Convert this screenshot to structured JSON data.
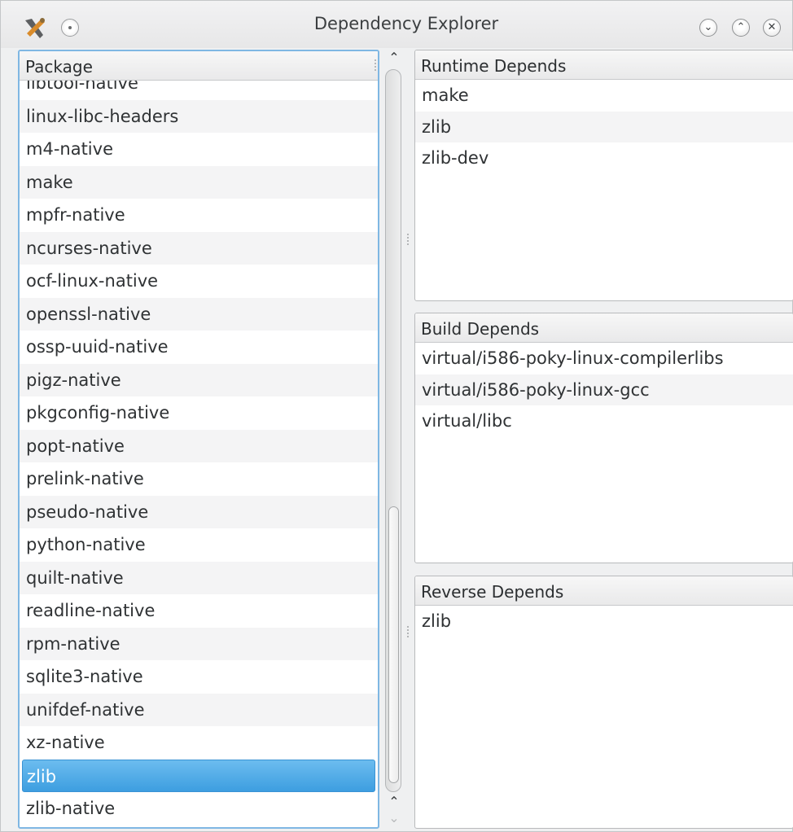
{
  "window": {
    "title": "Dependency Explorer",
    "buttons": [
      "minimize",
      "maximize",
      "close"
    ]
  },
  "package_list": {
    "header": "Package",
    "items": [
      "libtool-native",
      "linux-libc-headers",
      "m4-native",
      "make",
      "mpfr-native",
      "ncurses-native",
      "ocf-linux-native",
      "openssl-native",
      "ossp-uuid-native",
      "pigz-native",
      "pkgconfig-native",
      "popt-native",
      "prelink-native",
      "pseudo-native",
      "python-native",
      "quilt-native",
      "readline-native",
      "rpm-native",
      "sqlite3-native",
      "unifdef-native",
      "xz-native",
      "zlib",
      "zlib-native"
    ],
    "selected": "zlib"
  },
  "runtime_depends": {
    "header": "Runtime Depends",
    "items": [
      "make",
      "zlib",
      "zlib-dev"
    ]
  },
  "build_depends": {
    "header": "Build Depends",
    "items": [
      "virtual/i586-poky-linux-compilerlibs",
      "virtual/i586-poky-linux-gcc",
      "virtual/libc"
    ]
  },
  "reverse_depends": {
    "header": "Reverse Depends",
    "items": [
      "zlib"
    ]
  },
  "colors": {
    "selection": "#3d9ee0",
    "focus_border": "#7fb7e3"
  }
}
